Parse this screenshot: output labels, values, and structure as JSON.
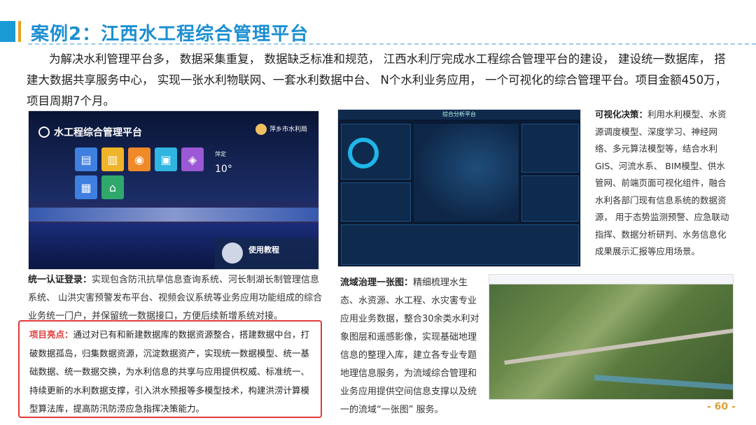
{
  "slide": {
    "title": "案例2：江西水工程综合管理平台",
    "intro": "为解决水利管理平台多， 数据采集重复， 数据缺乏标准和规范， 江西水利厅完成水工程综合管理平台的建设， 建设统一数据库， 搭建大数据共享服务中心， 实现一张水利物联网、一套水利数据中台、 N个水利业务应用， 一个可视化的综合管理平台。项目金额450万， 项目周期7个月。",
    "page_number": "- 60 -"
  },
  "screen1": {
    "header": "水工程综合管理平台",
    "user": "萍乡市水利局",
    "weather_city": "萍定",
    "weather_temp": "10°",
    "guide": "使用教程"
  },
  "screen2": {
    "title": "综合分析平台"
  },
  "captions": {
    "login_label": "统一认证登录：",
    "login_text": "实现包含防汛抗旱信息查询系统、河长制湖长制管理信息系统、 山洪灾害预警发布平台、视频会议系统等业务应用功能组成的综合业务统一门户，并保留统一数据接口，方便后续新增系统对接。",
    "basin_label": "流域治理一张图：",
    "basin_text": "精细梳理水生态、水资源、水工程、水灾害专业应用业务数据，整合30余类水利对象图层和遥感影像，实现基础地理信息的整理入库，建立各专业专题地理信息服务，为流域综合管理和业务应用提供空间信息支撑以及统一的流域“一张图” 服务。",
    "visual_label": "可视化决策：",
    "visual_text": "利用水利模型、水资源调度模型、深度学习、神经网络、多元算法模型等，结合水利GIS、河流水系、 BIM模型、供水管网、前端页面可视化组件，融合水利各部门现有信息系统的数据资源， 用于态势监测预警、应急联动指挥、数据分析研判、水务信息化成果展示汇报等应用场景。"
  },
  "highlight": {
    "label": "项目亮点：",
    "text": "通过对已有和新建数据库的数据资源整合，搭建数据中台，打破数据孤岛，归集数据资源，沉淀数据资产，实现统一数据模型、统一基础数据、统一数据交换，为水利信息的共享与应用提供权威、标准统一、持续更新的水利数据支撑，引入洪水预报等多模型技术，构建洪涝计算模型算法库，提高防汛防涝应急指挥决策能力。"
  },
  "colors": {
    "accent": "#1b8fd2",
    "highlight_border": "#e23b3b",
    "page_number": "#d9a23b"
  }
}
